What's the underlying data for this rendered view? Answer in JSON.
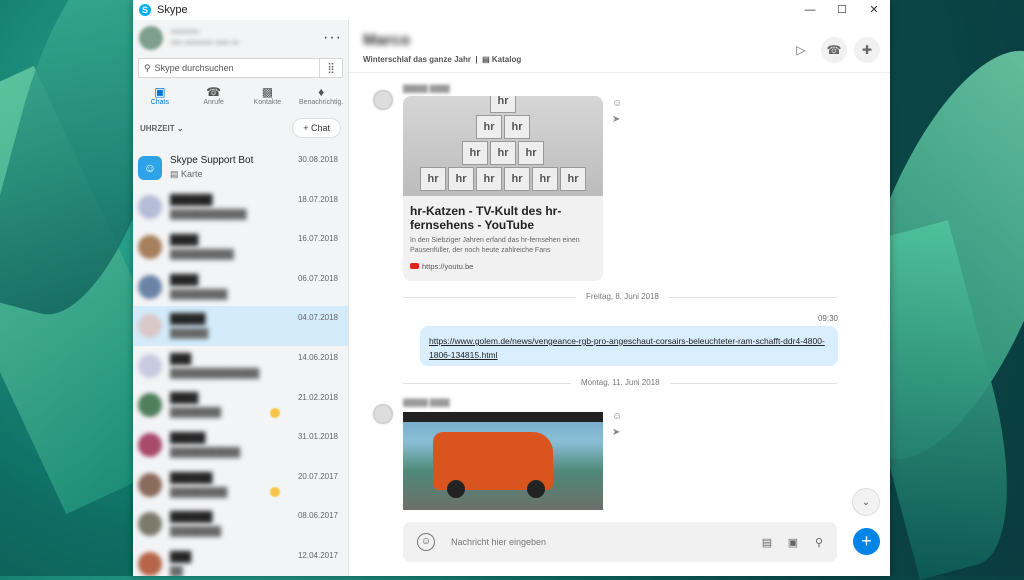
{
  "window": {
    "title": "Skype",
    "controls": [
      "—",
      "☐",
      "✕"
    ]
  },
  "sidebar": {
    "profile": {
      "name": "••••••••",
      "status": "••• •••••••• •••• ••"
    },
    "more": "···",
    "search": {
      "placeholder": "Skype durchsuchen",
      "icon": "search-icon",
      "dialpad": "⣿"
    },
    "nav": [
      {
        "label": "Chats",
        "icon": "chat-icon",
        "active": true
      },
      {
        "label": "Anrufe",
        "icon": "phone-icon"
      },
      {
        "label": "Kontakte",
        "icon": "contacts-icon"
      },
      {
        "label": "Benachrichtig.",
        "icon": "bell-icon"
      }
    ],
    "sort_label": "UHRZEIT ⌄",
    "new_chat": "+ Chat",
    "chats": [
      {
        "name": "Skype Support Bot",
        "sub": "Karte",
        "date": "30.08.2018"
      },
      {
        "name": "",
        "sub": "",
        "date": "18.07.2018"
      },
      {
        "name": "",
        "sub": "",
        "date": "16.07.2018"
      },
      {
        "name": "",
        "sub": "",
        "date": "06.07.2018"
      },
      {
        "name": "",
        "sub": "",
        "date": "04.07.2018"
      },
      {
        "name": "",
        "sub": "",
        "date": "14.06.2018"
      },
      {
        "name": "",
        "sub": "",
        "date": "21.02.2018"
      },
      {
        "name": "",
        "sub": "",
        "date": "31.01.2018"
      },
      {
        "name": "",
        "sub": "",
        "date": "20.07.2017"
      },
      {
        "name": "",
        "sub": "",
        "date": "08.06.2017"
      },
      {
        "name": "",
        "sub": "",
        "date": "12.04.2017"
      }
    ]
  },
  "conversation": {
    "contact_name": "Marco",
    "status": "Winterschlaf das ganze Jahr",
    "catalog": "Katalog",
    "header_icons": [
      "video-icon",
      "call-icon",
      "add-person-icon"
    ],
    "card": {
      "title": "hr-Katzen - TV-Kult des hr-fernsehens - YouTube",
      "description": "In den Siebziger Jahren erfand das hr-fernsehen einen Pausenfüller, der noch heute zahlreiche Fans",
      "link": "https://youtu.be",
      "thumb_blocks": [
        "hr",
        "hr",
        "hr",
        "hr",
        "hr",
        "hr",
        "hr",
        "hr",
        "hr",
        "hr",
        "hr",
        "hr"
      ]
    },
    "divider1": "Freitag, 8. Juni 2018",
    "out_time": "09:30",
    "out_link": "https://www.golem.de/news/vengeance-rgb-pro-angeschaut-corsairs-beleuchteter-ram-schafft-ddr4-4800-1806-134815.html",
    "divider2": "Montag, 11. Juni 2018",
    "composer_placeholder": "Nachricht hier eingeben"
  }
}
